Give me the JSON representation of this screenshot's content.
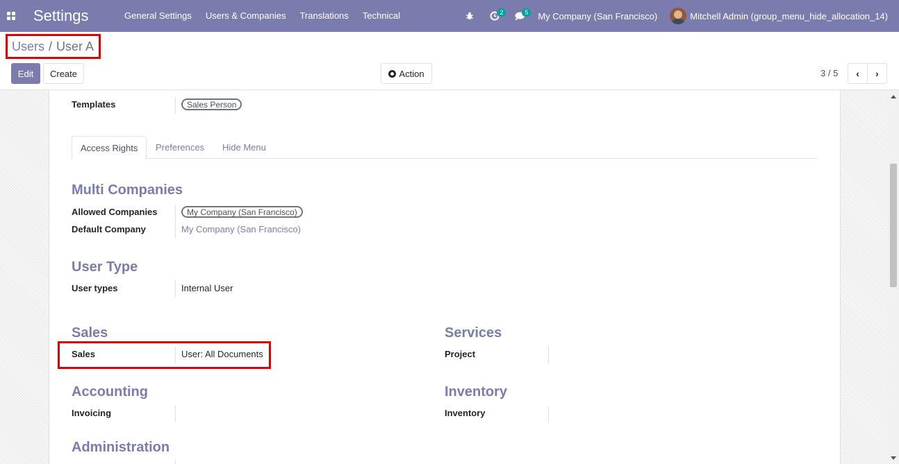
{
  "navbar": {
    "app_title": "Settings",
    "menu": [
      "General Settings",
      "Users & Companies",
      "Translations",
      "Technical"
    ],
    "activity_count": "2",
    "messages_count": "5",
    "company": "My Company (San Francisco)",
    "user": "Mitchell Admin (group_menu_hide_allocation_14)"
  },
  "breadcrumb": {
    "parent": "Users",
    "separator": "/",
    "current": "User A"
  },
  "buttons": {
    "edit": "Edit",
    "create": "Create",
    "action": "Action"
  },
  "pager": {
    "value": "3 / 5"
  },
  "form": {
    "templates_label": "Templates",
    "templates_tag": "Sales Person",
    "tabs": [
      {
        "label": "Access Rights",
        "active": true
      },
      {
        "label": "Preferences",
        "active": false
      },
      {
        "label": "Hide Menu",
        "active": false
      }
    ],
    "multi_companies": {
      "title": "Multi Companies",
      "allowed_label": "Allowed Companies",
      "allowed_tag": "My Company (San Francisco)",
      "default_label": "Default Company",
      "default_value": "My Company (San Francisco)"
    },
    "user_type": {
      "title": "User Type",
      "label": "User types",
      "value": "Internal User"
    },
    "sales": {
      "title": "Sales",
      "label": "Sales",
      "value": "User: All Documents"
    },
    "services": {
      "title": "Services",
      "label": "Project",
      "value": ""
    },
    "accounting": {
      "title": "Accounting",
      "label": "Invoicing",
      "value": ""
    },
    "inventory": {
      "title": "Inventory",
      "label": "Inventory",
      "value": ""
    },
    "administration": {
      "title": "Administration"
    }
  },
  "colors": {
    "brand": "#7c7bad",
    "highlight": "#e20000",
    "badge": "#00a09d"
  }
}
